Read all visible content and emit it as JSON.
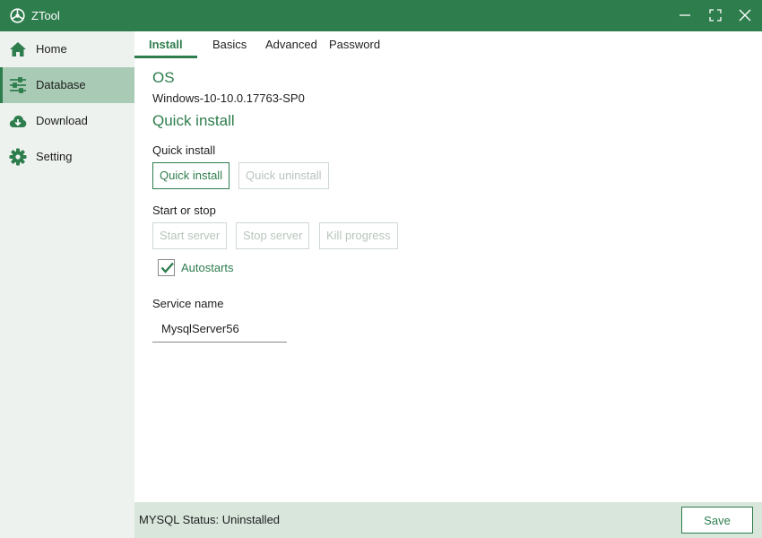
{
  "window": {
    "title": "ZTool",
    "accent_color": "#2e7d4d",
    "icons": [
      "logo-icon",
      "minimize-icon",
      "maximize-icon",
      "close-icon"
    ]
  },
  "sidebar": {
    "items": [
      {
        "label": "Home",
        "icon": "home-icon",
        "active": false
      },
      {
        "label": "Database",
        "icon": "sliders-icon",
        "active": true
      },
      {
        "label": "Download",
        "icon": "cloud-download-icon",
        "active": false
      },
      {
        "label": "Setting",
        "icon": "gear-icon",
        "active": false
      }
    ]
  },
  "tabs": [
    {
      "label": "Install",
      "active": true
    },
    {
      "label": "Basics",
      "active": false
    },
    {
      "label": "Advanced",
      "active": false
    },
    {
      "label": "Password",
      "active": false
    }
  ],
  "os": {
    "title": "OS",
    "value": "Windows-10-10.0.17763-SP0"
  },
  "quick_install": {
    "title": "Quick install",
    "group_label": "Quick install",
    "install_button": "Quick install",
    "uninstall_button": "Quick uninstall"
  },
  "start_stop": {
    "group_label": "Start or stop",
    "start_button": "Start server",
    "stop_button": "Stop server",
    "kill_button": "Kill progress"
  },
  "autostarts": {
    "label": "Autostarts",
    "checked": true
  },
  "service": {
    "label": "Service name",
    "value": "MysqlServer56"
  },
  "statusbar": {
    "status_text": "MYSQL Status: Uninstalled",
    "save_label": "Save"
  }
}
